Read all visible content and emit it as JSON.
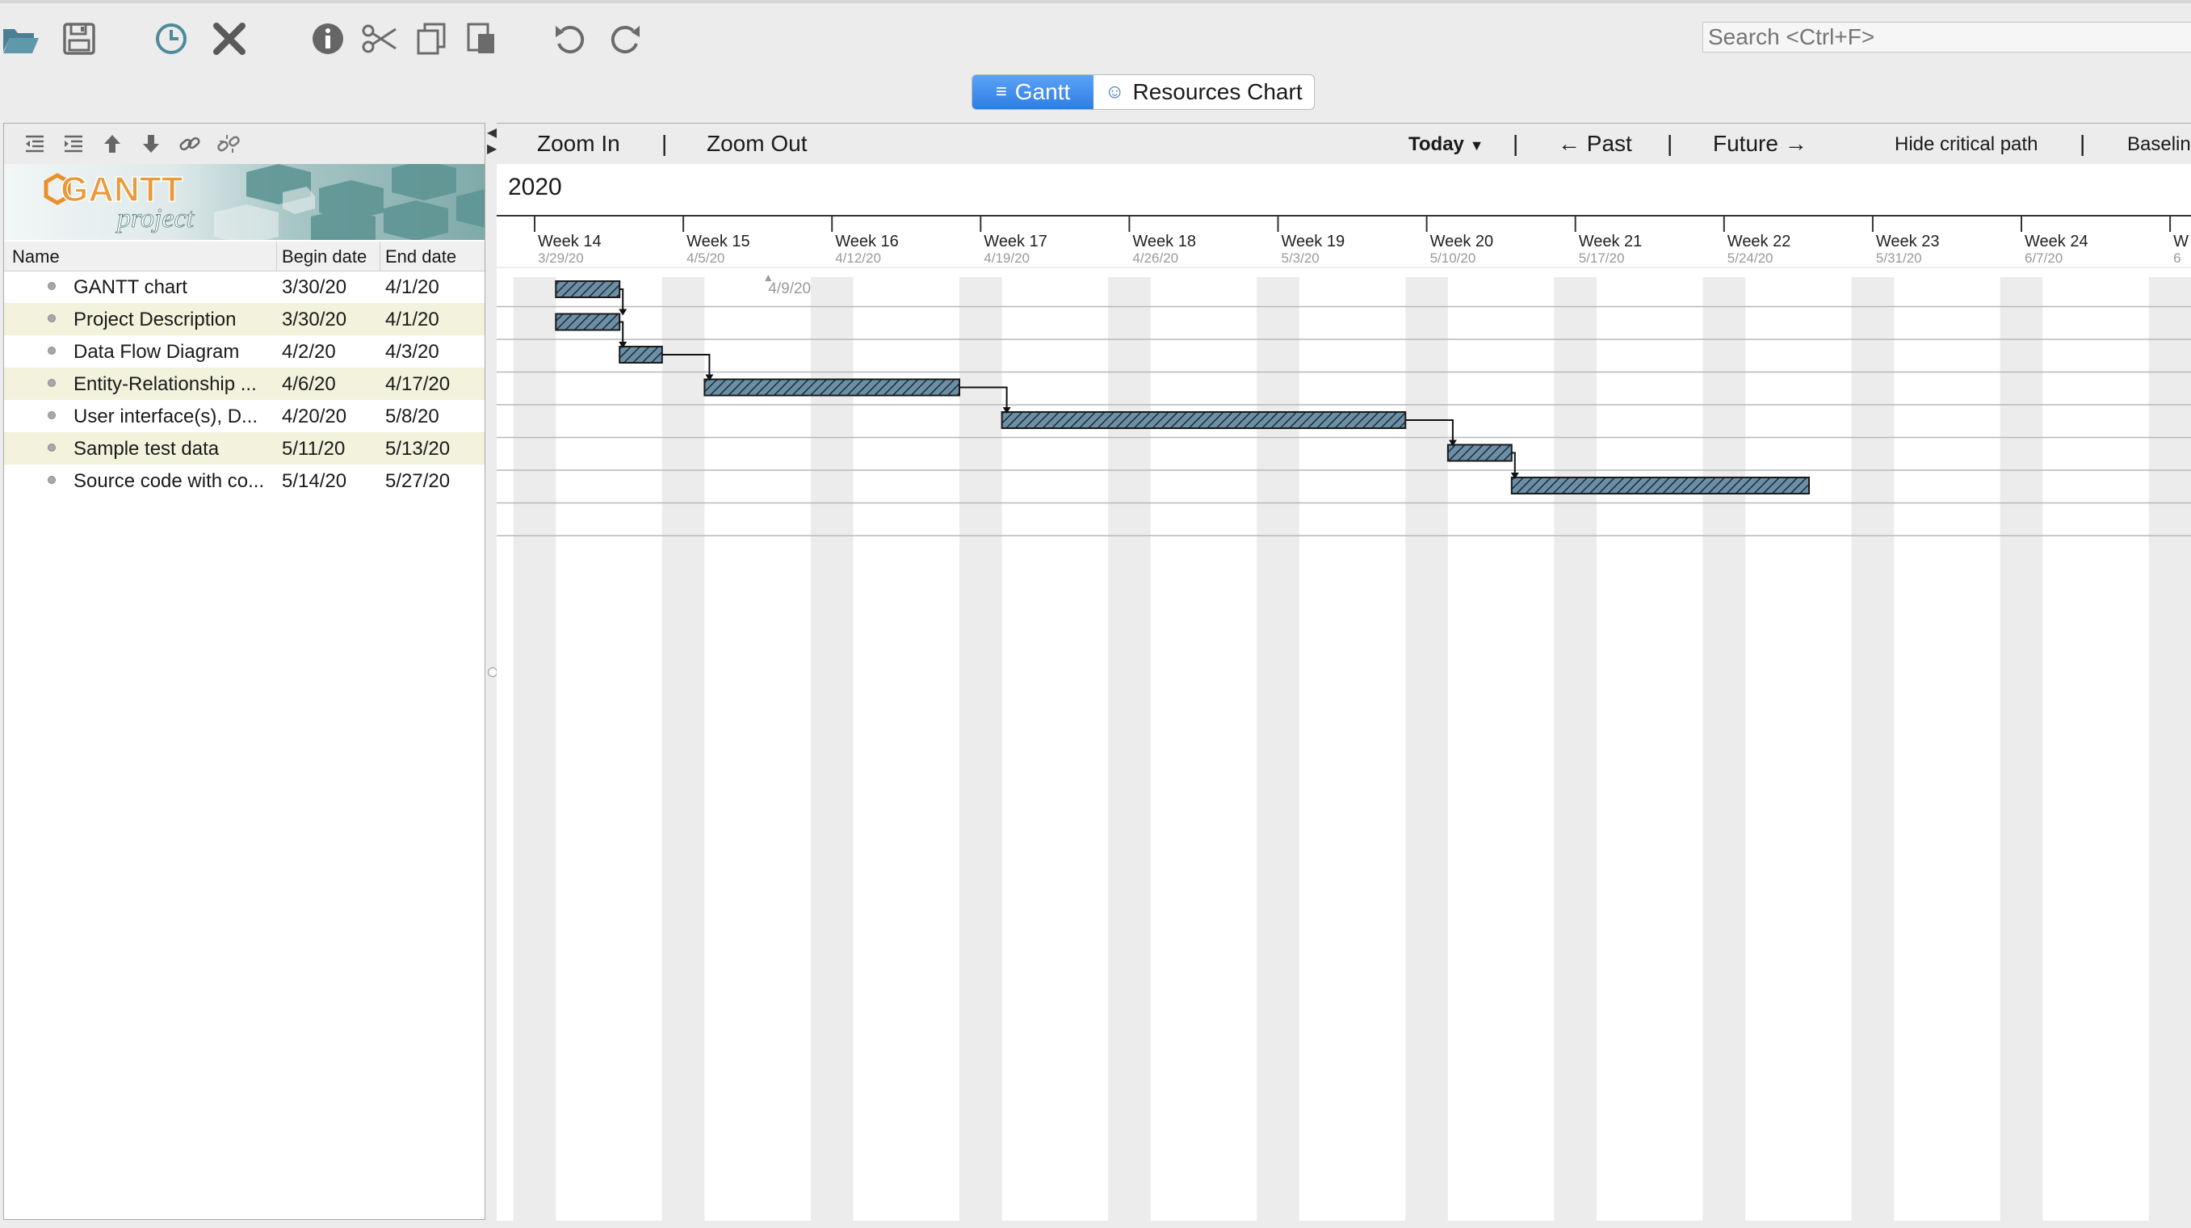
{
  "toolbar": {
    "icons": [
      "open-folder-icon",
      "save-icon",
      "history-icon",
      "close-icon",
      "info-icon",
      "cut-icon",
      "copy-icon",
      "paste-icon",
      "undo-icon",
      "redo-icon"
    ],
    "search_placeholder": "Search <Ctrl+F>"
  },
  "view_tabs": [
    {
      "label": "Gantt",
      "active": true
    },
    {
      "label": "Resources Chart",
      "active": false
    }
  ],
  "task_tree": {
    "toolbar_icons": [
      "unindent-icon",
      "indent-icon",
      "move-up-icon",
      "move-down-icon",
      "link-icon",
      "unlink-icon"
    ],
    "logo_text": "GANTT",
    "logo_subtext": "project",
    "columns": [
      "Name",
      "Begin date",
      "End date"
    ],
    "rows": [
      {
        "name": "GANTT chart",
        "begin": "3/30/20",
        "end": "4/1/20"
      },
      {
        "name": "Project Description",
        "begin": "3/30/20",
        "end": "4/1/20"
      },
      {
        "name": "Data Flow Diagram",
        "begin": "4/2/20",
        "end": "4/3/20"
      },
      {
        "name": "Entity-Relationship ...",
        "begin": "4/6/20",
        "end": "4/17/20"
      },
      {
        "name": "User interface(s), D...",
        "begin": "4/20/20",
        "end": "5/8/20"
      },
      {
        "name": "Sample test data",
        "begin": "5/11/20",
        "end": "5/13/20"
      },
      {
        "name": "Source code with co...",
        "begin": "5/14/20",
        "end": "5/27/20"
      }
    ]
  },
  "gantt_toolbar": {
    "zoom_in": "Zoom In",
    "sep1": "|",
    "zoom_out": "Zoom Out",
    "today": "Today",
    "sep2": "|",
    "past": "← Past",
    "sep3": "|",
    "future": "Future →",
    "hide_critical": "Hide critical path",
    "sep4": "|",
    "baseline": "Baselin"
  },
  "timeline": {
    "year": "2020",
    "weeks": [
      {
        "label": "Week 14",
        "date": "3/29/20"
      },
      {
        "label": "Week 15",
        "date": "4/5/20"
      },
      {
        "label": "Week 16",
        "date": "4/12/20"
      },
      {
        "label": "Week 17",
        "date": "4/19/20"
      },
      {
        "label": "Week 18",
        "date": "4/26/20"
      },
      {
        "label": "Week 19",
        "date": "5/3/20"
      },
      {
        "label": "Week 20",
        "date": "5/10/20"
      },
      {
        "label": "Week 21",
        "date": "5/17/20"
      },
      {
        "label": "Week 22",
        "date": "5/24/20"
      },
      {
        "label": "Week 23",
        "date": "5/31/20"
      },
      {
        "label": "Week 24",
        "date": "6/7/20"
      },
      {
        "label": "W",
        "date": "6"
      }
    ],
    "today_marker": "4/9/20"
  },
  "colors": {
    "bar_fill": "#6b8fa6",
    "bar_stroke": "#1a1a1a",
    "weekend": "#ececec",
    "active_tab": "#3a86e8",
    "alt_row": "#f2f2dd"
  }
}
